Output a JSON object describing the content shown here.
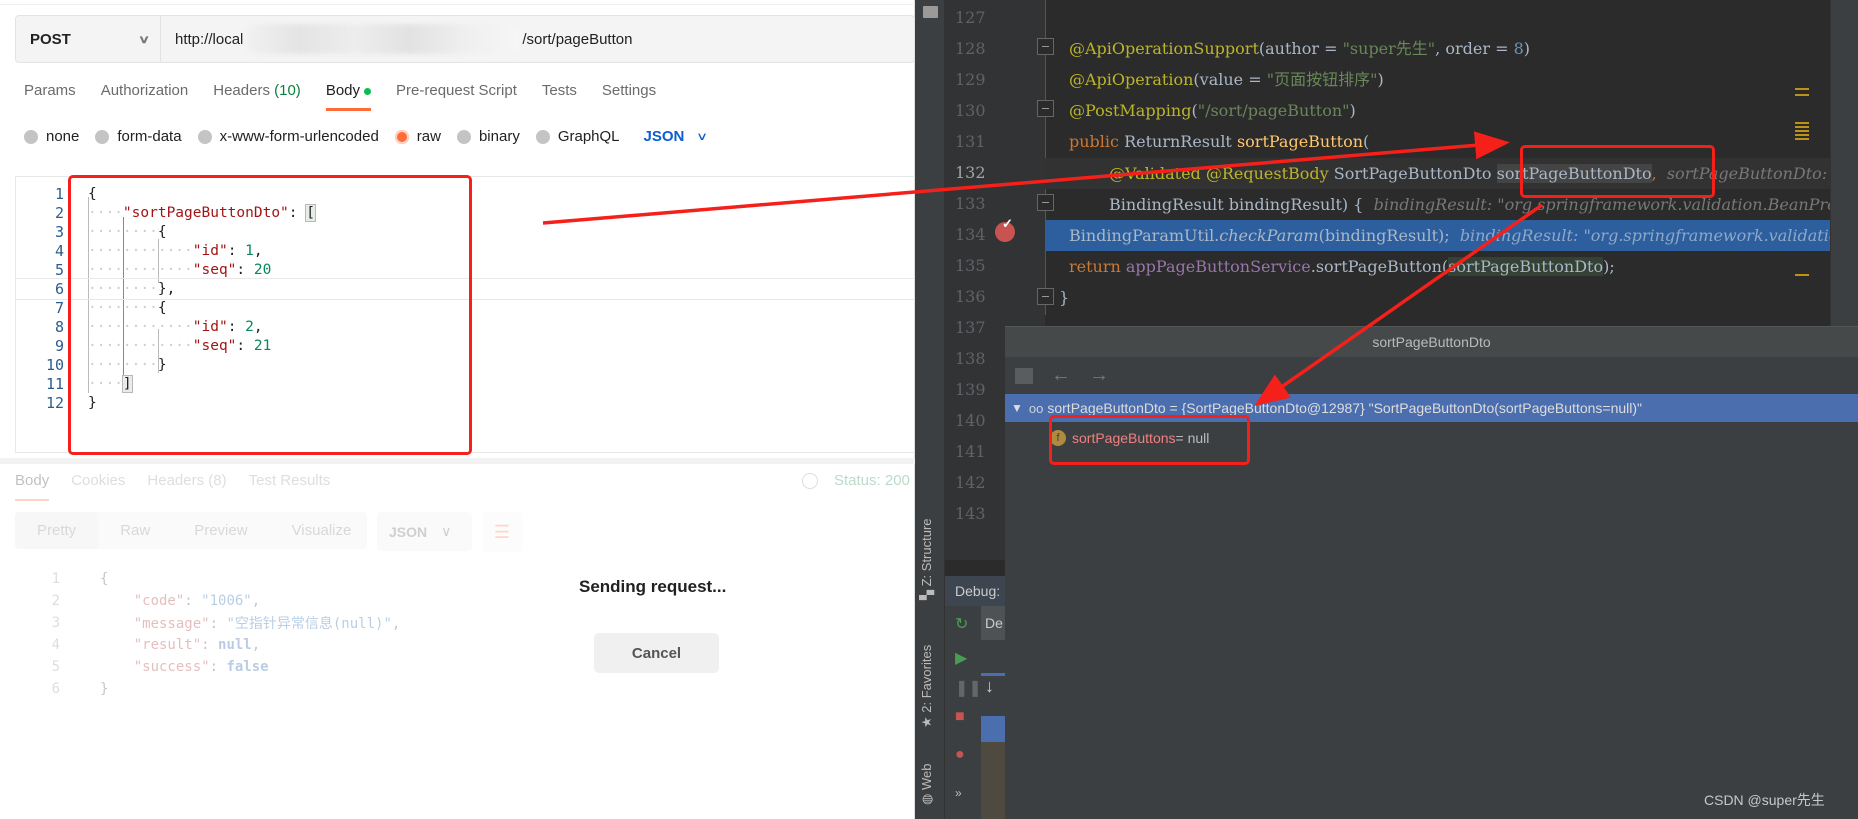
{
  "postman": {
    "method": "POST",
    "url_prefix": "http://local",
    "url_suffix": "/sort/pageButton",
    "request_tabs": [
      {
        "label": "Params"
      },
      {
        "label": "Authorization"
      },
      {
        "label": "Headers",
        "count": "(10)"
      },
      {
        "label": "Body",
        "active": true
      },
      {
        "label": "Pre-request Script"
      },
      {
        "label": "Tests"
      },
      {
        "label": "Settings"
      }
    ],
    "body_types": [
      "none",
      "form-data",
      "x-www-form-urlencoded",
      "raw",
      "binary",
      "GraphQL"
    ],
    "selected_body_type": "raw",
    "raw_format": "JSON",
    "request_body_lines": [
      "{",
      "    \"sortPageButtonDto\": [",
      "        {",
      "            \"id\": 1,",
      "            \"seq\": 20",
      "        },",
      "        {",
      "            \"id\": 2,",
      "            \"seq\": 21",
      "        }",
      "    ]",
      "}"
    ],
    "response": {
      "tabs": [
        "Body",
        "Cookies",
        "Headers (8)",
        "Test Results"
      ],
      "status": "Status: 200",
      "format_tabs": [
        "Pretty",
        "Raw",
        "Preview",
        "Visualize"
      ],
      "language": "JSON",
      "lines": [
        "{",
        "    \"code\": \"1006\",",
        "    \"message\": \"空指针异常信息(null)\",",
        "    \"result\": null,",
        "    \"success\": false",
        "}"
      ]
    },
    "sending_text": "Sending request...",
    "cancel_label": "Cancel"
  },
  "ide": {
    "line_numbers": [
      "127",
      "128",
      "129",
      "130",
      "131",
      "132",
      "133",
      "134",
      "135",
      "136",
      "137",
      "138",
      "139",
      "140",
      "141",
      "142",
      "143"
    ],
    "code": {
      "l128": {
        "ann": "@ApiOperationSupport",
        "a": "(author = ",
        "s": "\"super先生\"",
        "b": ", order = ",
        "n": "8",
        "c": ")"
      },
      "l129": {
        "ann": "@ApiOperation",
        "a": "(value = ",
        "s": "\"页面按钮排序\"",
        "c": ")"
      },
      "l130": {
        "ann": "@PostMapping",
        "a": "(",
        "s": "\"/sort/pageButton\"",
        "c": ")"
      },
      "l131": {
        "kw": "public ",
        "type": "ReturnResult ",
        "fn": "sortPageButton",
        "c": "("
      },
      "l132": {
        "ann": "@Validated @RequestBody ",
        "type": "SortPageButtonDto ",
        "param": "sortPageButtonDto",
        "comma": ",",
        "hint": "sortPageButtonDto: \"SortPageButtonDto(sortPageButtons=null)\""
      },
      "l133": {
        "text": "BindingResult bindingResult) {",
        "hint": "bindingResult: \"org.springframework.validation.BeanPropertyBindingResult\""
      },
      "l134": {
        "cls": "BindingParamUtil.",
        "method": "checkParam",
        "args": "(bindingResult);",
        "hint": "bindingResult: \"org.springframework.validation\""
      },
      "l135": {
        "kw": "return ",
        "fld": "appPageButtonService",
        "mid": ".sortPageButton(",
        "param": "sortPageButtonDto",
        "end": ");"
      },
      "l136": {
        "text": "}"
      }
    },
    "tool_windows": [
      "Z: Structure",
      "2: Favorites",
      "Web"
    ],
    "debug_label": "Debug:",
    "debug_tab_partial": "De",
    "popup": {
      "title": "sortPageButtonDto",
      "root_row": "sortPageButtonDto = {SortPageButtonDto@12987} \"SortPageButtonDto(sortPageButtons=null)\"",
      "child_field": "sortPageButtons",
      "child_value": " = null",
      "field_badge": "f"
    }
  },
  "watermark": "CSDN @super先生",
  "colors": {
    "postman_accent": "#ff6c37",
    "annotation_red": "#f5201a",
    "ide_selection": "#4b6eaf",
    "exec_line": "#2d5f9e"
  }
}
